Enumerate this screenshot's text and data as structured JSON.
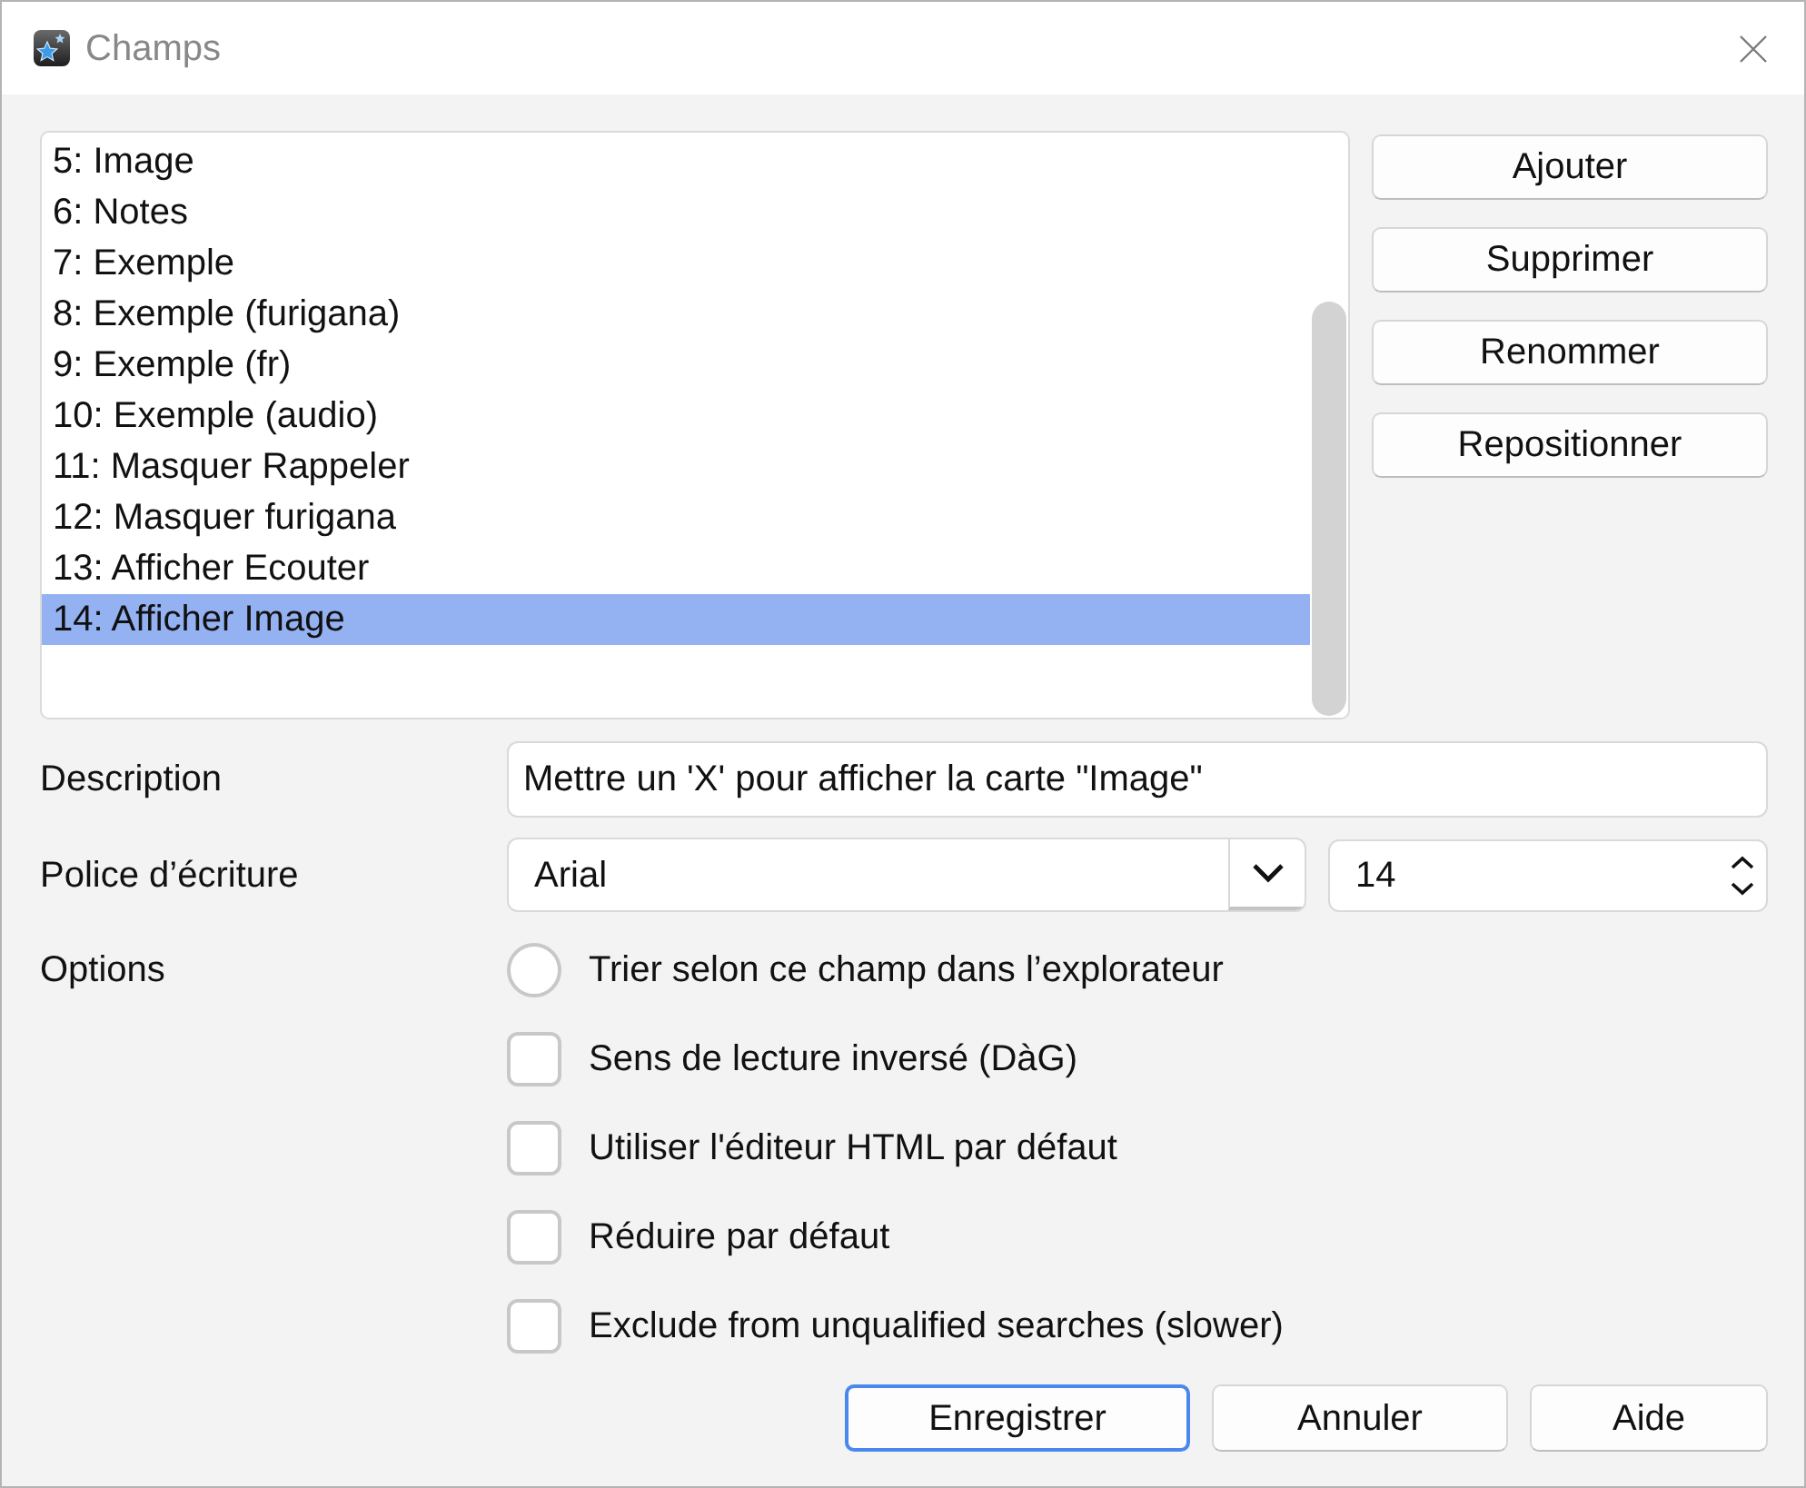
{
  "window": {
    "title": "Champs"
  },
  "field_list": {
    "items": [
      {
        "label": "5: Image",
        "selected": false
      },
      {
        "label": "6: Notes",
        "selected": false
      },
      {
        "label": "7: Exemple",
        "selected": false
      },
      {
        "label": "8: Exemple (furigana)",
        "selected": false
      },
      {
        "label": "9: Exemple (fr)",
        "selected": false
      },
      {
        "label": "10: Exemple (audio)",
        "selected": false
      },
      {
        "label": "11: Masquer Rappeler",
        "selected": false
      },
      {
        "label": "12: Masquer furigana",
        "selected": false
      },
      {
        "label": "13: Afficher Ecouter",
        "selected": false
      },
      {
        "label": "14: Afficher Image",
        "selected": true
      }
    ]
  },
  "side_buttons": [
    "Ajouter",
    "Supprimer",
    "Renommer",
    "Repositionner"
  ],
  "description": {
    "label": "Description",
    "value": "Mettre un 'X' pour afficher la carte \"Image\""
  },
  "font": {
    "label": "Police d’écriture",
    "family": "Arial",
    "size": "14"
  },
  "options": {
    "label": "Options",
    "items": [
      {
        "kind": "radio",
        "label": "Trier selon ce champ dans l’explorateur",
        "checked": false
      },
      {
        "kind": "checkbox",
        "label": "Sens de lecture inversé (DàG)",
        "checked": false
      },
      {
        "kind": "checkbox",
        "label": "Utiliser l'éditeur HTML par défaut",
        "checked": false
      },
      {
        "kind": "checkbox",
        "label": "Réduire par défaut",
        "checked": false
      },
      {
        "kind": "checkbox",
        "label": "Exclude from unqualified searches (slower)",
        "checked": false
      }
    ]
  },
  "buttons": [
    {
      "label": "Enregistrer",
      "focused": true
    },
    {
      "label": "Annuler",
      "focused": false
    },
    {
      "label": "Aide",
      "focused": false
    }
  ]
}
